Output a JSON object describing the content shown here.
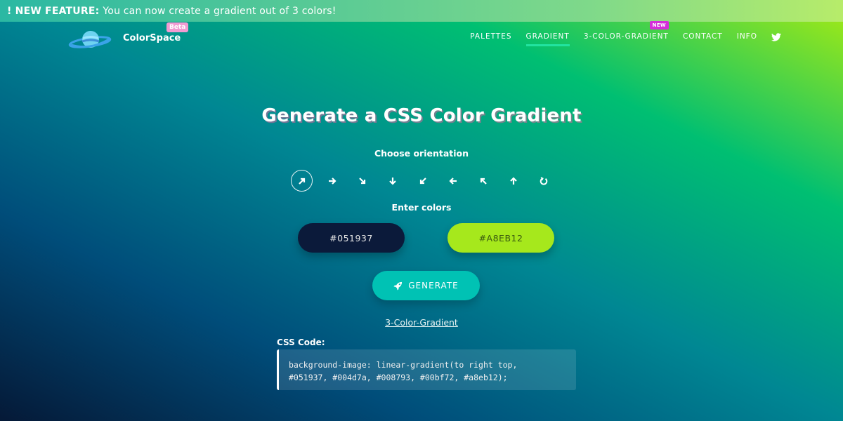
{
  "banner": {
    "prefix": "! NEW FEATURE:",
    "text": "You can now create a gradient out of 3 colors!"
  },
  "brand": {
    "name": "ColorSpace",
    "badge": "Beta"
  },
  "nav": {
    "items": [
      "PALETTES",
      "GRADIENT",
      "3-COLOR-GRADIENT",
      "CONTACT",
      "INFO"
    ],
    "active": "GRADIENT",
    "new_badge": "NEW",
    "social_icon": "twitter-icon"
  },
  "main": {
    "title": "Generate a CSS Color Gradient",
    "orientation_label": "Choose orientation",
    "orientations": [
      {
        "icon": "arrow-up-right-icon",
        "selected": true
      },
      {
        "icon": "arrow-right-icon"
      },
      {
        "icon": "arrow-down-right-icon"
      },
      {
        "icon": "arrow-down-icon"
      },
      {
        "icon": "arrow-down-left-icon"
      },
      {
        "icon": "arrow-left-icon"
      },
      {
        "icon": "arrow-up-left-icon"
      },
      {
        "icon": "arrow-up-icon"
      },
      {
        "icon": "radial-icon"
      }
    ],
    "colors_label": "Enter colors",
    "color1": "#051937",
    "color2": "#A8EB12",
    "generate_label": "GENERATE",
    "link_3color": "3-Color-Gradient",
    "css_label": "CSS Code:",
    "css_line1": "background-image: linear-gradient(to right top,",
    "css_line2": "#051937, #004d7a, #008793, #00bf72, #a8eb12);"
  },
  "colors": {
    "color1_bg": "#0b1a3a",
    "color2_bg": "#a6e81c",
    "generate_bg": "#00c2b4",
    "nav_underline": "#22e3a0",
    "beta_badge": "#f29bd2",
    "new_badge": "#d42fd9"
  }
}
